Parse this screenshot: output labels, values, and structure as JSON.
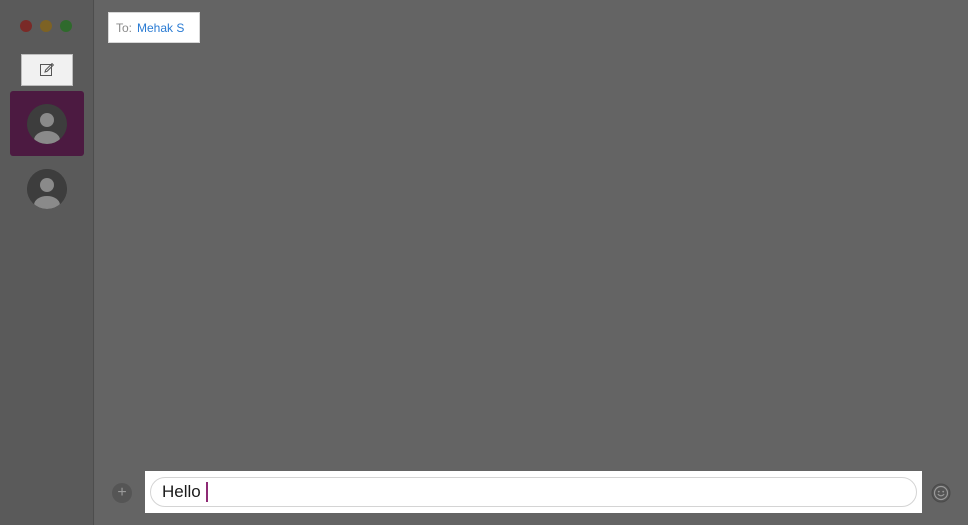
{
  "window": {
    "traffic_lights": {
      "close_color": "#7a2a27",
      "minimize_color": "#7d6224",
      "maximize_color": "#2f6a2c"
    }
  },
  "sidebar": {
    "compose_icon": "compose-icon",
    "conversations": [
      {
        "avatar_icon": "person-avatar-icon",
        "selected": true
      },
      {
        "avatar_icon": "person-avatar-icon",
        "selected": false
      }
    ],
    "selected_color": "#4c1a41"
  },
  "header": {
    "to_label": "To:",
    "recipient": "Mehak S",
    "recipient_color": "#2a7bd3"
  },
  "composer": {
    "plus_icon": "+",
    "message_text": "Hello",
    "emoji_icon": "emoji-icon",
    "caret_color": "#8e2a74"
  }
}
